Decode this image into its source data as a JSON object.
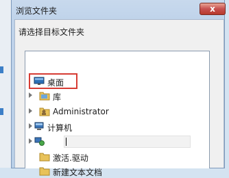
{
  "window": {
    "title": "浏览文件夹",
    "close_label": "x",
    "prompt": "请选择目标文件夹"
  },
  "tree": {
    "items": [
      {
        "label": "桌面",
        "icon": "desktop-icon",
        "expandable": false,
        "selected": true
      },
      {
        "label": "库",
        "icon": "library-icon",
        "expandable": true
      },
      {
        "label": "Administrator",
        "icon": "user-folder-icon",
        "expandable": true
      },
      {
        "label": "计算机",
        "icon": "computer-icon",
        "expandable": true
      },
      {
        "label": "",
        "icon": "network-icon",
        "expandable": true
      },
      {
        "label": "激活.驱动",
        "icon": "folder-icon",
        "expandable": false
      },
      {
        "label": "新建文本文档",
        "icon": "folder-icon",
        "expandable": false
      }
    ]
  },
  "colors": {
    "highlight_border": "#d63b33",
    "folder": "#e8c25a",
    "title_bar": "#c8d9ed"
  }
}
